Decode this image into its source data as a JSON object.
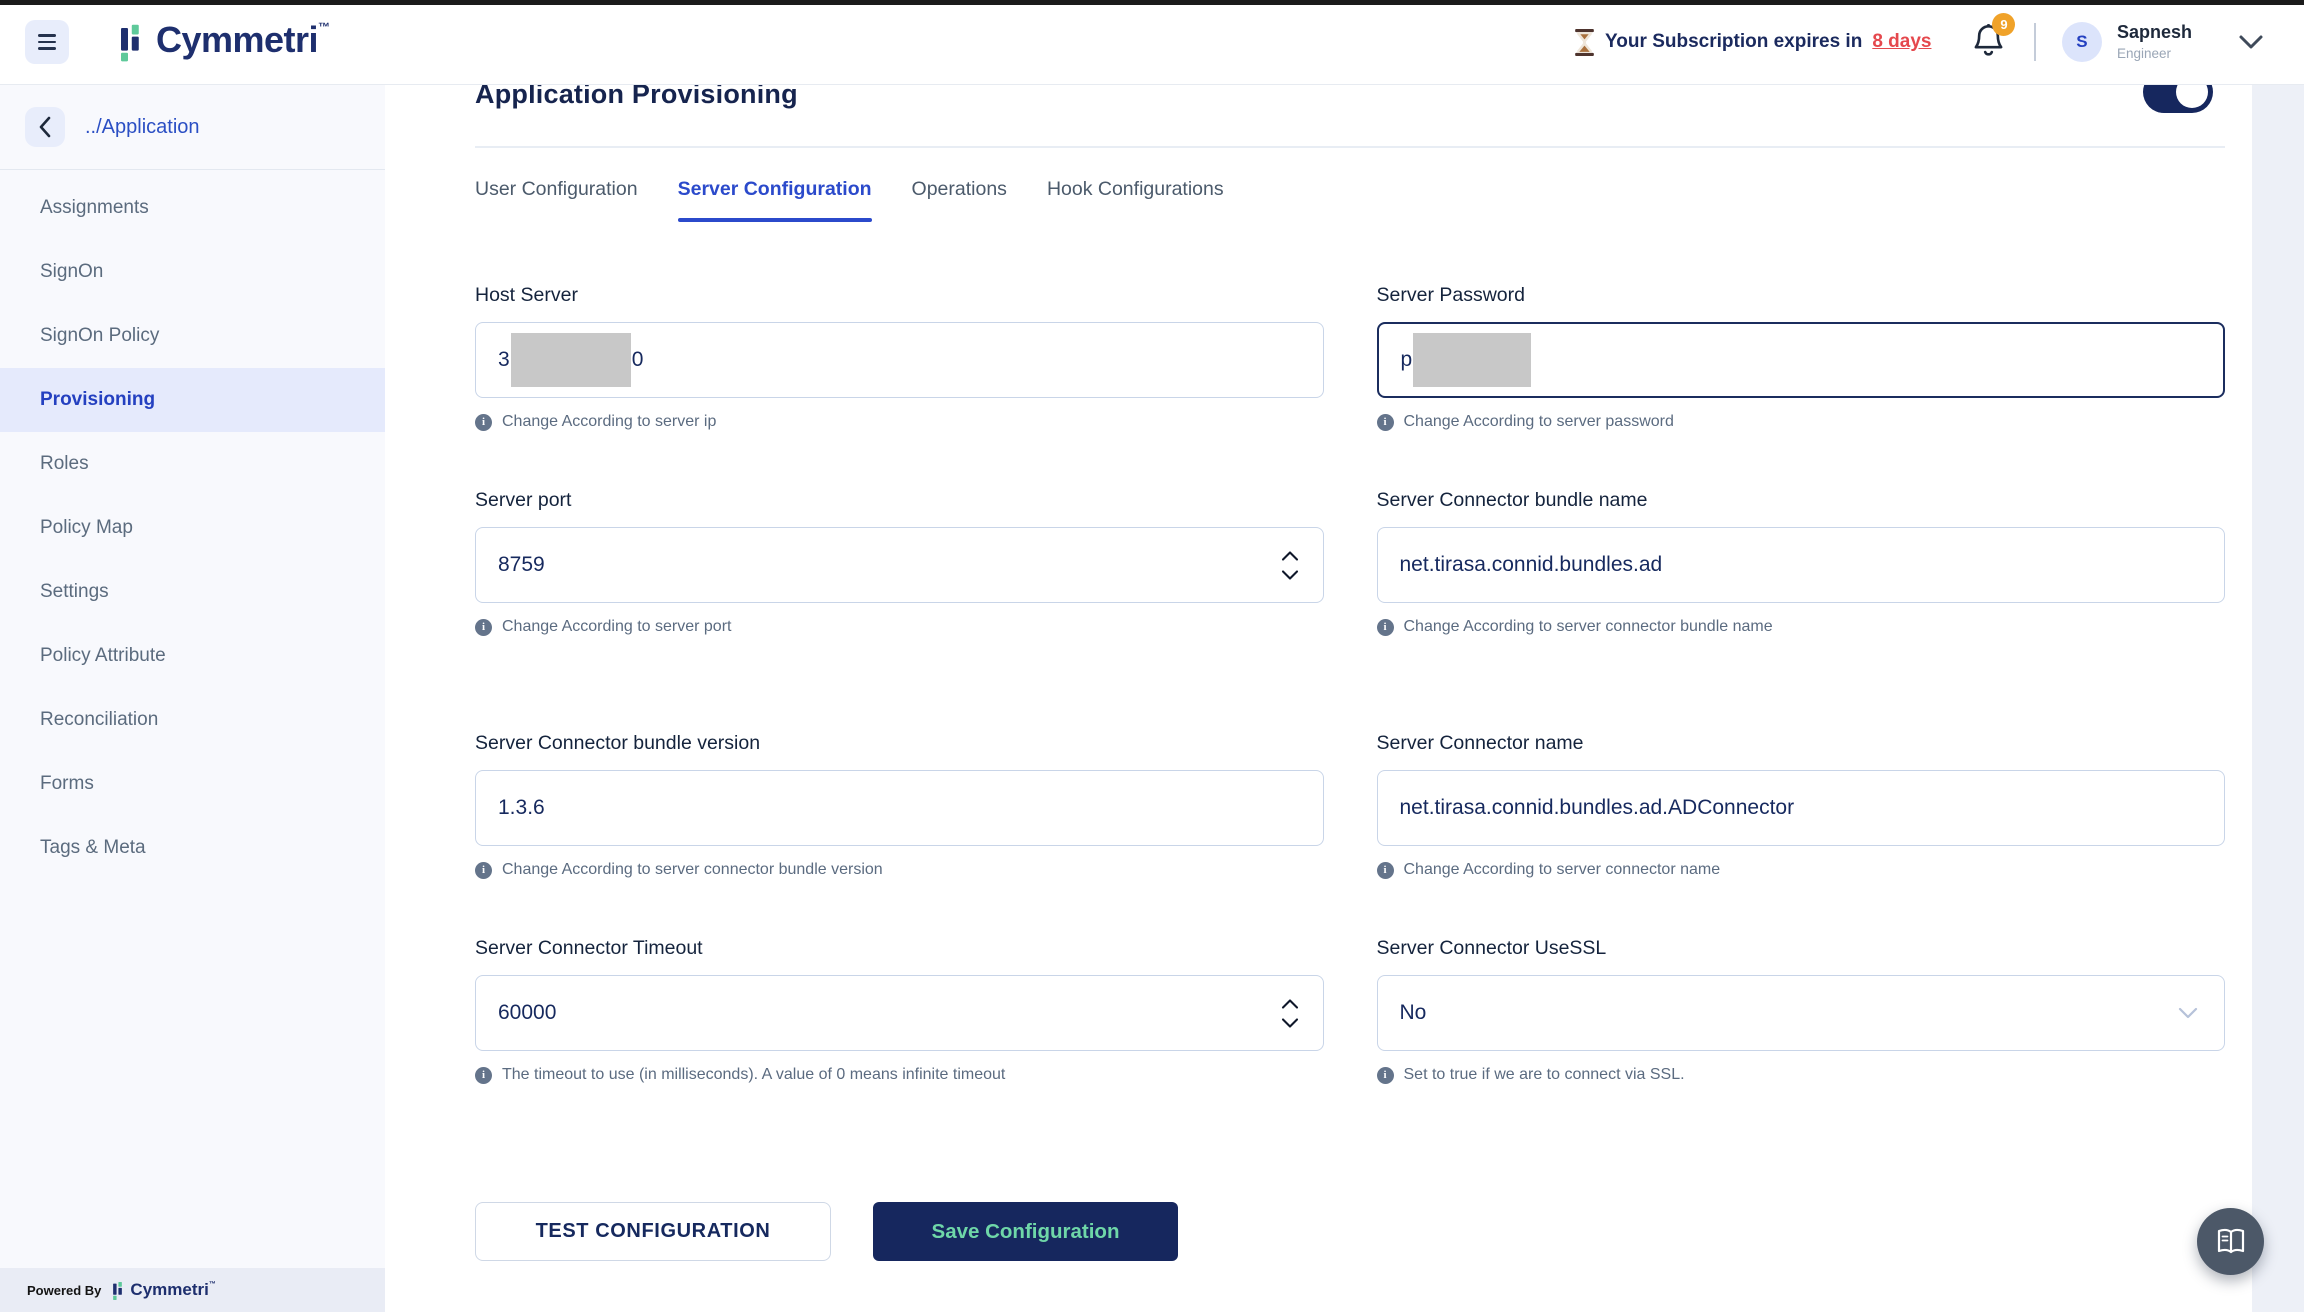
{
  "header": {
    "logo_text": "Cymmetri",
    "logo_tm": "™",
    "subscription_prefix": "Your Subscription expires in",
    "subscription_link": "8 days",
    "notification_count": "9",
    "user_initial": "S",
    "user_name": "Sapnesh",
    "user_role": "Engineer"
  },
  "sidebar": {
    "back_label": "../Application",
    "items": [
      {
        "label": "Assignments",
        "active": false
      },
      {
        "label": "SignOn",
        "active": false
      },
      {
        "label": "SignOn Policy",
        "active": false
      },
      {
        "label": "Provisioning",
        "active": true
      },
      {
        "label": "Roles",
        "active": false
      },
      {
        "label": "Policy Map",
        "active": false
      },
      {
        "label": "Settings",
        "active": false
      },
      {
        "label": "Policy Attribute",
        "active": false
      },
      {
        "label": "Reconciliation",
        "active": false
      },
      {
        "label": "Forms",
        "active": false
      },
      {
        "label": "Tags & Meta",
        "active": false
      }
    ],
    "powered_by": "Powered By",
    "brand": "Cymmetri",
    "brand_tm": "™"
  },
  "main": {
    "title": "Application Provisioning",
    "toggle_state": "on",
    "tabs": [
      {
        "label": "User Configuration",
        "active": false
      },
      {
        "label": "Server Configuration",
        "active": true
      },
      {
        "label": "Operations",
        "active": false
      },
      {
        "label": "Hook Configurations",
        "active": false
      }
    ],
    "fields": [
      {
        "label": "Host Server",
        "value_prefix": "3",
        "value_suffix": "0",
        "redacted": true,
        "helper": "Change According to server ip"
      },
      {
        "label": "Server Password",
        "value_prefix": "p",
        "value_suffix": "",
        "redacted": true,
        "helper": "Change According to server password"
      },
      {
        "label": "Server port",
        "value": "8759",
        "helper": "Change According to server port"
      },
      {
        "label": "Server Connector bundle name",
        "value": "net.tirasa.connid.bundles.ad",
        "helper": "Change According to server connector bundle name"
      },
      {
        "label": "Server Connector bundle version",
        "value": "1.3.6",
        "helper": "Change According to server connector bundle version"
      },
      {
        "label": "Server Connector name",
        "value": "net.tirasa.connid.bundles.ad.ADConnector",
        "helper": "Change According to server connector name"
      },
      {
        "label": "Server Connector Timeout",
        "value": "60000",
        "helper": "The timeout to use (in milliseconds). A value of 0 means infinite timeout"
      },
      {
        "label": "Server Connector UseSSL",
        "value": "No",
        "helper": "Set to true if we are to connect via SSL."
      }
    ],
    "test_button": "TEST CONFIGURATION",
    "save_button": "Save Configuration"
  },
  "colors": {
    "accent_blue": "#2b4acb",
    "navy": "#16275e",
    "save_text_green": "#6fd7a8",
    "alert_red": "#e5484d",
    "badge_orange": "#f0a229",
    "sidebar_active_bg": "#e5eafc",
    "logo_green": "#5ec99a"
  }
}
